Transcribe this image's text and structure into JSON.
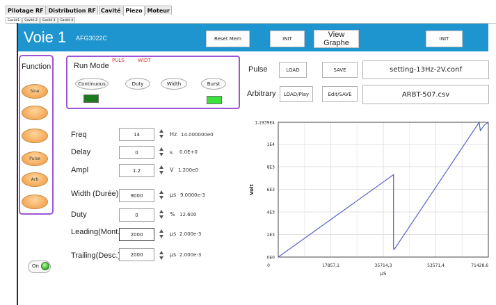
{
  "main_tabs": [
    "Pilotage RF",
    "Distribution RF",
    "Cavité",
    "Piezo",
    "Moteur"
  ],
  "active_main_tab": 3,
  "sub_tabs": [
    "Cavité1",
    "Cavité 2",
    "Cavité 3",
    "Cavité 4"
  ],
  "header": {
    "channel_title": "Voie 1",
    "device_model": "AFG3022C",
    "reset_mem_label": "Reset Mem",
    "init_left_label": "INIT",
    "view_graph_label": "View Graphe",
    "init_right_label": "INIT",
    "header_color": "#1e95cf"
  },
  "function_panel": {
    "title": "Function",
    "buttons": [
      "Sine",
      "",
      "",
      "Pulse",
      "Arb",
      ""
    ]
  },
  "run_mode": {
    "title": "Run Mode",
    "flag_puls": "PULS",
    "flag_widt": "WIDT",
    "buttons": [
      "Continuous",
      "Duty",
      "Width",
      "Burst"
    ],
    "continuous_led_color": "#1f7a1f",
    "burst_led_color": "#3ee03e"
  },
  "params": [
    {
      "label": "Freq",
      "value": "14",
      "unit": "Hz",
      "readback": "14.000000e0"
    },
    {
      "label": "Delay",
      "value": "0",
      "unit": "s",
      "readback": "0.0E+0"
    },
    {
      "label": "Ampl",
      "value": "1.2",
      "unit": "V",
      "readback": "1.200e0"
    },
    {
      "label": "Width (Durée)",
      "value": "9000",
      "unit": "µs",
      "readback": "9.0000e-3"
    },
    {
      "label": "Duty",
      "value": "0",
      "unit": "%",
      "readback": "12.600"
    },
    {
      "label": "Leading(Mont.)",
      "value": "2000",
      "unit": "µs",
      "readback": "2.000e-3"
    },
    {
      "label": "Trailing(Desc.)",
      "value": "2000",
      "unit": "µs",
      "readback": "2.000e-3"
    }
  ],
  "power": {
    "label": "On"
  },
  "pulse_row": {
    "label": "Pulse",
    "load": "LOAD",
    "save": "SAVE",
    "file": "setting-13Hz-2V.conf"
  },
  "arb_row": {
    "label": "Arbitrary",
    "load": "LOAD/Play",
    "save": "Edit/SAVE",
    "file": "ARBT-507.csv"
  },
  "chart_data": {
    "type": "line",
    "xlabel": "µS",
    "ylabel": "Volt",
    "x_ticks": [
      "0",
      "17857,1",
      "35714,3",
      "53571,4",
      "71428,6"
    ],
    "y_ticks": [
      "0E0",
      "2E3",
      "4E3",
      "6E3",
      "8E3",
      "1E4",
      "1,1939E4"
    ],
    "xlim": [
      0,
      71428.6
    ],
    "ylim": [
      0,
      11939
    ],
    "grid": true,
    "series": [
      {
        "color": "#5860c8",
        "x": [
          0,
          39200,
          39200,
          39500,
          68300,
          68700,
          70100,
          71428.6
        ],
        "y": [
          0,
          7300,
          700,
          700,
          11939,
          11200,
          11700,
          11939
        ]
      }
    ]
  }
}
